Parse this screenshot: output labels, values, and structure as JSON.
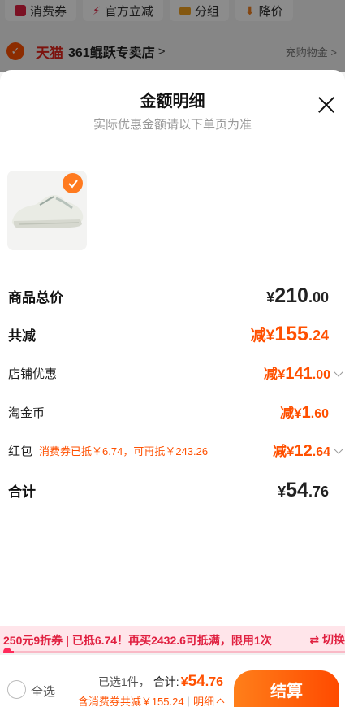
{
  "background": {
    "chips": [
      {
        "label": "消费券",
        "icon": "coupon-icon",
        "color": "#e02040"
      },
      {
        "label": "官方立减",
        "icon": "lightning-icon",
        "color": "#e02040"
      },
      {
        "label": "分组",
        "icon": "folder-icon",
        "color": "#f0a020"
      },
      {
        "label": "降价",
        "icon": "price-down-icon",
        "color": "#f08020"
      }
    ],
    "store": {
      "brand": "天猫",
      "name": "361鲲跃专卖店",
      "chevron": ">",
      "refill": "充购物金 >"
    }
  },
  "sheet": {
    "title": "金额明细",
    "subtitle": "实际优惠金额请以下单页为准",
    "rows": {
      "subtotal": {
        "label": "商品总价",
        "sym": "¥",
        "int": "210",
        "dec": ".00"
      },
      "total_discount": {
        "label": "共减",
        "sym": "减¥",
        "int": "155",
        "dec": ".24"
      },
      "store_discount": {
        "label": "店铺优惠",
        "sym": "减¥",
        "int": "141",
        "dec": ".00"
      },
      "taojinbi": {
        "label": "淘金币",
        "sym": "减¥",
        "int": "1",
        "dec": ".60"
      },
      "red_packet": {
        "label": "红包",
        "note": "消费券已抵￥6.74，可再抵￥243.26",
        "sym": "减¥",
        "int": "12",
        "dec": ".64"
      },
      "total": {
        "label": "合计",
        "sym": "¥",
        "int": "54",
        "dec": ".76"
      }
    }
  },
  "promo": {
    "text": "250元9折券 | 已抵6.74！再买2432.6可抵满，限用1次",
    "switch": "⇄ 切换",
    "progress": 0.027
  },
  "bottom": {
    "select_all": "全选",
    "selected": "已选1件，",
    "total_label": "合计:",
    "total_sym": "¥",
    "total_int": "54",
    "total_dec": ".76",
    "discount_text": "含消费券共减￥155.24",
    "detail": "明细",
    "checkout": "结算"
  },
  "colors": {
    "accent": "#ff5000",
    "promo_red": "#e02040"
  }
}
